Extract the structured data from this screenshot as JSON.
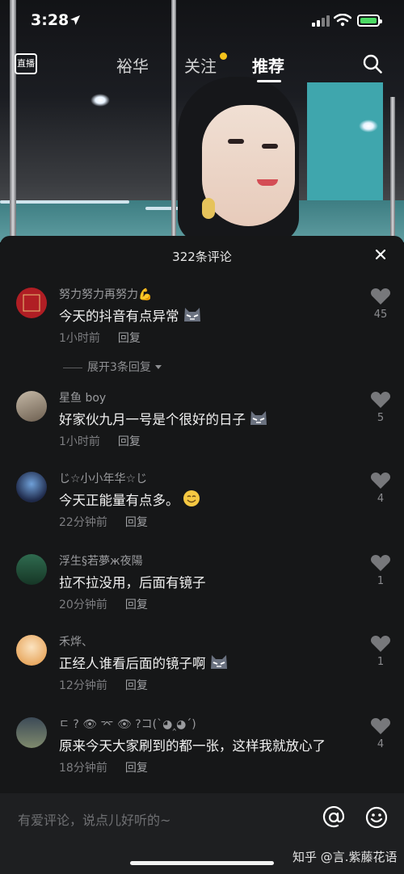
{
  "status_bar": {
    "time": "3:28"
  },
  "top_nav": {
    "live_label": "直播",
    "tabs": [
      {
        "label": "裕华",
        "active": false
      },
      {
        "label": "关注",
        "active": false,
        "badge_dot": true
      },
      {
        "label": "推荐",
        "active": true
      }
    ]
  },
  "comments_panel": {
    "title": "322条评论",
    "expand_replies": "展开3条回复",
    "comments": [
      {
        "name": "努力努力再努力💪",
        "text": "今天的抖音有点异常",
        "emoji": "cat",
        "time": "1小时前",
        "reply_label": "回复",
        "likes": "45",
        "avatar_color": "#b01e24"
      },
      {
        "name": "星鱼 boy",
        "text": "好家伙九月一号是个很好的日子",
        "emoji": "cat",
        "time": "1小时前",
        "reply_label": "回复",
        "likes": "5",
        "avatar_color": "#8a7b6a"
      },
      {
        "name": "じ☆小小年华☆じ",
        "text": "今天正能量有点多。",
        "emoji": "smile",
        "time": "22分钟前",
        "reply_label": "回复",
        "likes": "4",
        "avatar_color": "#1f2a4a"
      },
      {
        "name": "浮生§若夢ж夜陽",
        "text": "拉不拉没用，后面有镜子",
        "emoji": "",
        "time": "20分钟前",
        "reply_label": "回复",
        "likes": "1",
        "avatar_color": "#1e4a35"
      },
      {
        "name": "禾烨、",
        "text": "正经人谁看后面的镜子啊",
        "emoji": "cat",
        "time": "12分钟前",
        "reply_label": "回复",
        "likes": "1",
        "avatar_color": "#e9c9a0"
      },
      {
        "name": "ㄷ ? 👁 ⌤ 👁 ?コ(`◕‸◕´)",
        "text": "原来今天大家刷到的都一张，这样我就放心了",
        "emoji": "",
        "time": "18分钟前",
        "reply_label": "回复",
        "likes": "4",
        "avatar_color": "#5a5f58"
      }
    ]
  },
  "input_bar": {
    "placeholder": "有爱评论，说点儿好听的~",
    "watermark": "知乎 @言.紫藤花语"
  },
  "colors": {
    "panel_bg": "#161718",
    "accent_dot": "#f6c31b",
    "battery_green": "#4cd964"
  }
}
